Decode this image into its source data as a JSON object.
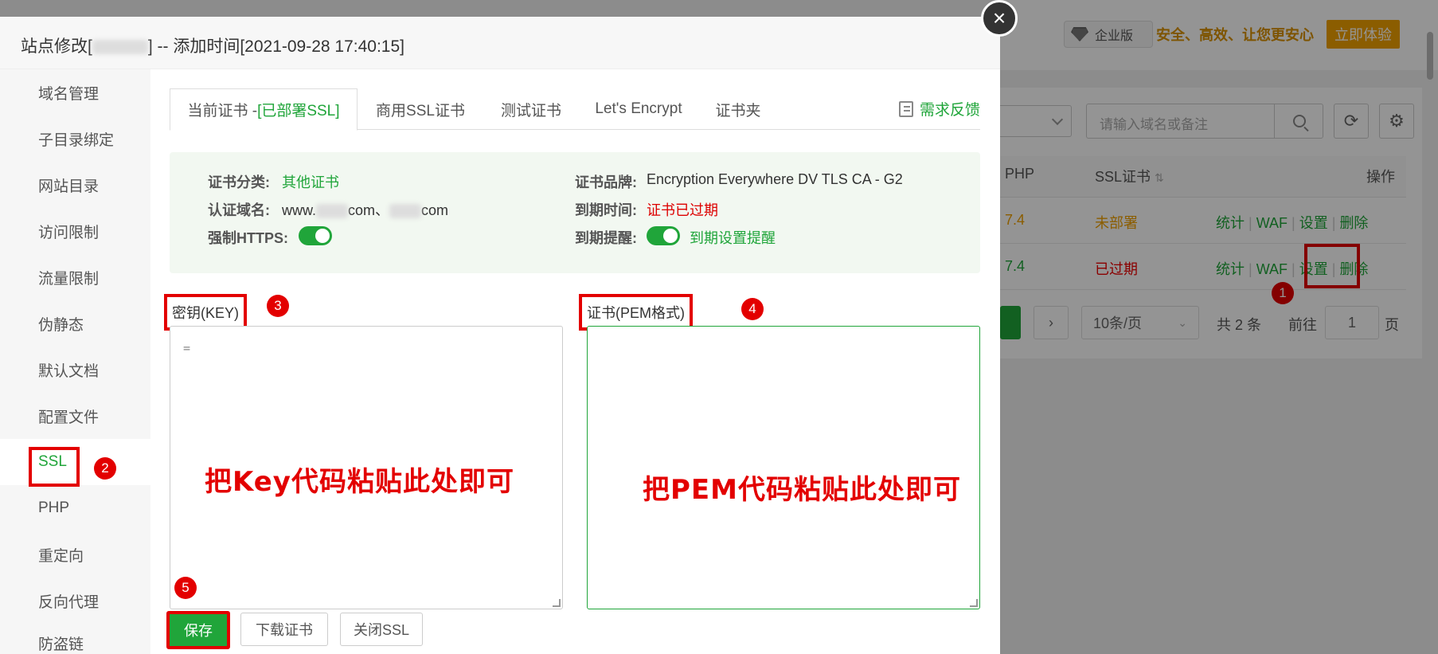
{
  "background": {
    "pro_badge": "企业版",
    "slogan": "安全、高效、让您更安心",
    "try_button": "立即体验",
    "search_placeholder": "请输入域名或备注",
    "table_headers": {
      "php": "PHP",
      "ssl": "SSL证书",
      "ops": "操作"
    },
    "rows": [
      {
        "php": "7.4",
        "ssl": "未部署",
        "ops": [
          "统计",
          "WAF",
          "设置",
          "删除"
        ]
      },
      {
        "php": "7.4",
        "ssl": "已过期",
        "ops": [
          "统计",
          "WAF",
          "设置",
          "删除"
        ]
      }
    ],
    "pagination": {
      "per_page": "10条/页",
      "total": "共 2 条",
      "goto_label": "前往",
      "page_value": "1",
      "page_suffix": "页"
    },
    "marker_1": "1"
  },
  "modal": {
    "title_prefix": "站点修改[",
    "title_suffix": "] -- 添加时间[2021-09-28 17:40:15]",
    "close_icon": "×",
    "sidebar": [
      "域名管理",
      "子目录绑定",
      "网站目录",
      "访问限制",
      "流量限制",
      "伪静态",
      "默认文档",
      "配置文件",
      "SSL",
      "PHP",
      "重定向",
      "反向代理",
      "防盗链"
    ],
    "sidebar_active": "SSL",
    "marker_2": "2",
    "tabs": {
      "current_prefix": "当前证书 - ",
      "current_status": "[已部署SSL]",
      "commercial": "商用SSL证书",
      "test": "测试证书",
      "letsencrypt": "Let's Encrypt",
      "folder": "证书夹",
      "feedback": "需求反馈"
    },
    "info": {
      "category_label": "证书分类:",
      "category_value": "其他证书",
      "domain_label": "认证域名:",
      "domain_value_a": "www.",
      "domain_value_b": "com、",
      "domain_value_c": "com",
      "https_label": "强制HTTPS:",
      "brand_label": "证书品牌:",
      "brand_value": "Encryption Everywhere DV TLS CA - G2",
      "expiry_label": "到期时间:",
      "expiry_value": "证书已过期",
      "reminder_label": "到期提醒:",
      "reminder_value": "到期设置提醒"
    },
    "key_label": "密钥(KEY)",
    "marker_3": "3",
    "cert_label": "证书(PEM格式)",
    "marker_4": "4",
    "key_content": "=",
    "key_hint": "把Key代码粘贴此处即可",
    "cert_hint": "把PEM代码粘贴此处即可",
    "marker_5": "5",
    "buttons": {
      "save": "保存",
      "download": "下载证书",
      "close_ssl": "关闭SSL"
    }
  },
  "colors": {
    "accent": "#20a53a",
    "annotation_red": "#e30000",
    "warning": "#f0a000"
  }
}
